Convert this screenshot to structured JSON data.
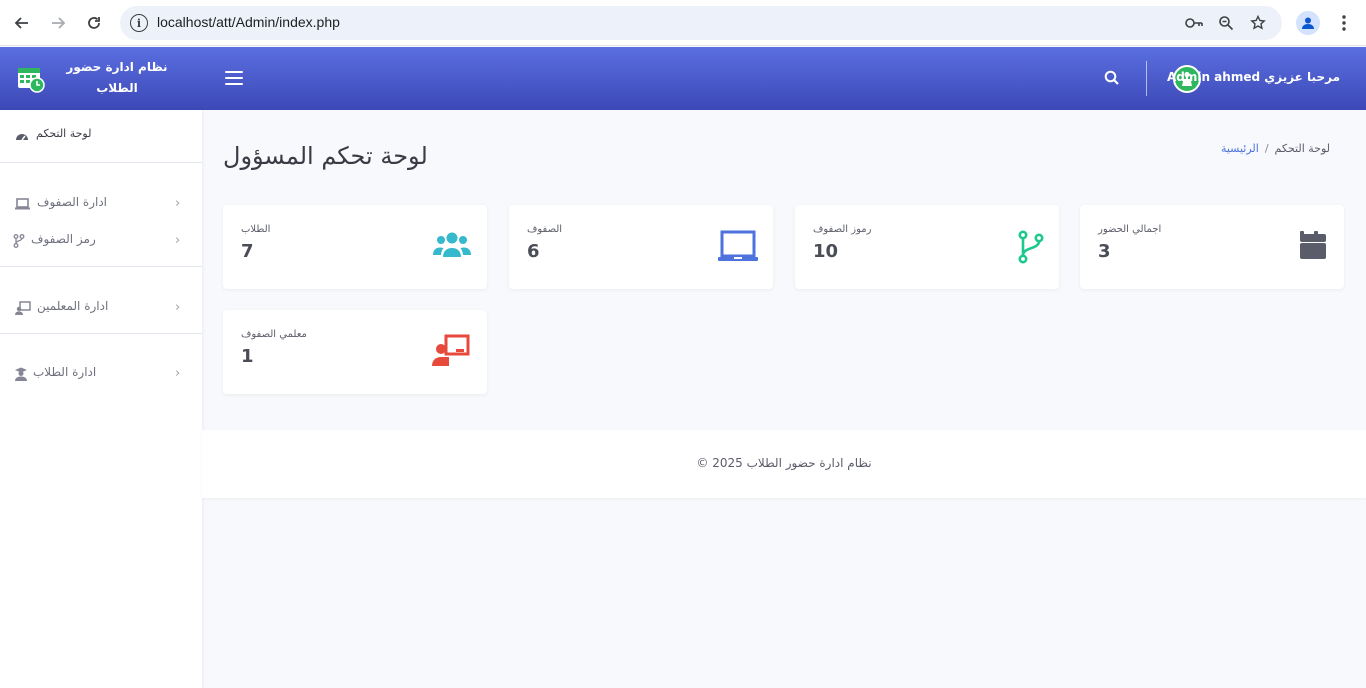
{
  "browser": {
    "url": "localhost/att/Admin/index.php"
  },
  "header": {
    "brand_line1": "نظام ادارة حضور",
    "brand_line2": "الطلاب",
    "user_greeting": "مرحبا عزيزي Admin ahmed",
    "accent_color": "#4e5fd0"
  },
  "sidebar": {
    "dashboard": "لوحة التحكم",
    "items": [
      {
        "label": "ادارة الصفوف",
        "icon": "laptop-icon"
      },
      {
        "label": "رمز الصفوف",
        "icon": "code-branch-icon"
      },
      {
        "label": "ادارة المعلمين",
        "icon": "chalkboard-teacher-icon"
      },
      {
        "label": "ادارة الطلاب",
        "icon": "user-graduate-icon"
      }
    ]
  },
  "main": {
    "title": "لوحة تحكم المسؤول",
    "breadcrumb": {
      "home": "الرئيسية",
      "separator": "/",
      "current": "لوحة التحكم"
    },
    "cards": [
      {
        "label": "الطلاب",
        "value": "7",
        "icon": "users-icon",
        "color": "#36b9cc"
      },
      {
        "label": "الصفوف",
        "value": "6",
        "icon": "laptop-icon",
        "color": "#4e73df"
      },
      {
        "label": "رموز الصفوف",
        "value": "10",
        "icon": "code-branch-icon",
        "color": "#1cc88a"
      },
      {
        "label": "اجمالي الحضور",
        "value": "3",
        "icon": "calendar-icon",
        "color": "#5a5c69"
      },
      {
        "label": "معلمي الصفوف",
        "value": "1",
        "icon": "chalkboard-teacher-icon",
        "color": "#e74a3b"
      }
    ]
  },
  "footer": {
    "text": "نظام ادارة حضور الطلاب 2025 ©"
  }
}
